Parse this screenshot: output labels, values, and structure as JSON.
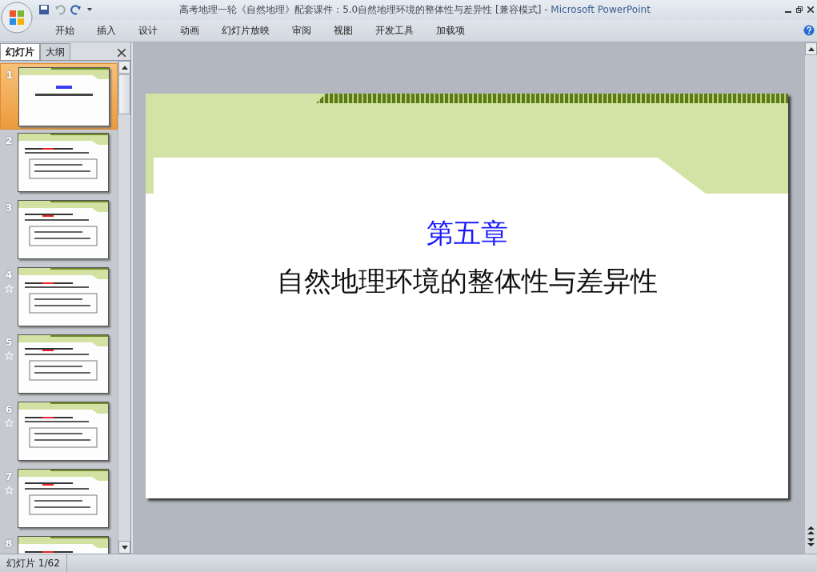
{
  "window": {
    "document_title": "高考地理一轮《自然地理》配套课件：5.0自然地理环境的整体性与差异性 [兼容模式]",
    "separator": " - ",
    "app_name": "Microsoft PowerPoint"
  },
  "ribbon_tabs": [
    {
      "label": "开始",
      "selected": false
    },
    {
      "label": "插入",
      "selected": false
    },
    {
      "label": "设计",
      "selected": false
    },
    {
      "label": "动画",
      "selected": false
    },
    {
      "label": "幻灯片放映",
      "selected": false
    },
    {
      "label": "审阅",
      "selected": false
    },
    {
      "label": "视图",
      "selected": false
    },
    {
      "label": "开发工具",
      "selected": false
    },
    {
      "label": "加载项",
      "selected": false
    }
  ],
  "pane_tabs": [
    {
      "label": "幻灯片",
      "selected": true
    },
    {
      "label": "大纲",
      "selected": false
    }
  ],
  "slides": [
    {
      "number": "1",
      "selected": true,
      "animated": false
    },
    {
      "number": "2",
      "selected": false,
      "animated": false
    },
    {
      "number": "3",
      "selected": false,
      "animated": false
    },
    {
      "number": "4",
      "selected": false,
      "animated": true
    },
    {
      "number": "5",
      "selected": false,
      "animated": true
    },
    {
      "number": "6",
      "selected": false,
      "animated": true
    },
    {
      "number": "7",
      "selected": false,
      "animated": true
    },
    {
      "number": "8",
      "selected": false,
      "animated": false
    }
  ],
  "slide": {
    "heading": "第五章",
    "title": "自然地理环境的整体性与差异性"
  },
  "status_bar": {
    "slide_indicator": "幻灯片 1/62"
  }
}
